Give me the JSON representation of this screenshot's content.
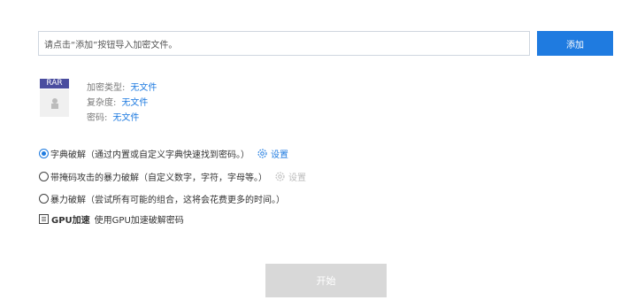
{
  "file_input": {
    "placeholder": "请点击“添加”按钮导入加密文件。"
  },
  "add_button": {
    "label": "添加"
  },
  "file_info": {
    "badge": "RAR",
    "rows": [
      {
        "label": "加密类型:",
        "value": "无文件"
      },
      {
        "label": "复杂度:",
        "value": "无文件"
      },
      {
        "label": "密码:",
        "value": "无文件"
      }
    ]
  },
  "options": [
    {
      "label": "字典破解（通过内置或自定义字典快速找到密码。）",
      "setting": "设置",
      "selected": true
    },
    {
      "label": "带掩码攻击的暴力破解（自定义数字，字符，字母等。）",
      "setting": "设置",
      "selected": false
    },
    {
      "label": "暴力破解（尝试所有可能的组合，这将会花费更多的时间。）",
      "selected": false
    }
  ],
  "gpu": {
    "title": "GPU加速",
    "desc": "使用GPU加速破解密码"
  },
  "start_button": {
    "label": "开始"
  },
  "colors": {
    "accent": "#1f7be0",
    "badge": "#4a4d9f",
    "disabled": "#d8d8d8"
  }
}
